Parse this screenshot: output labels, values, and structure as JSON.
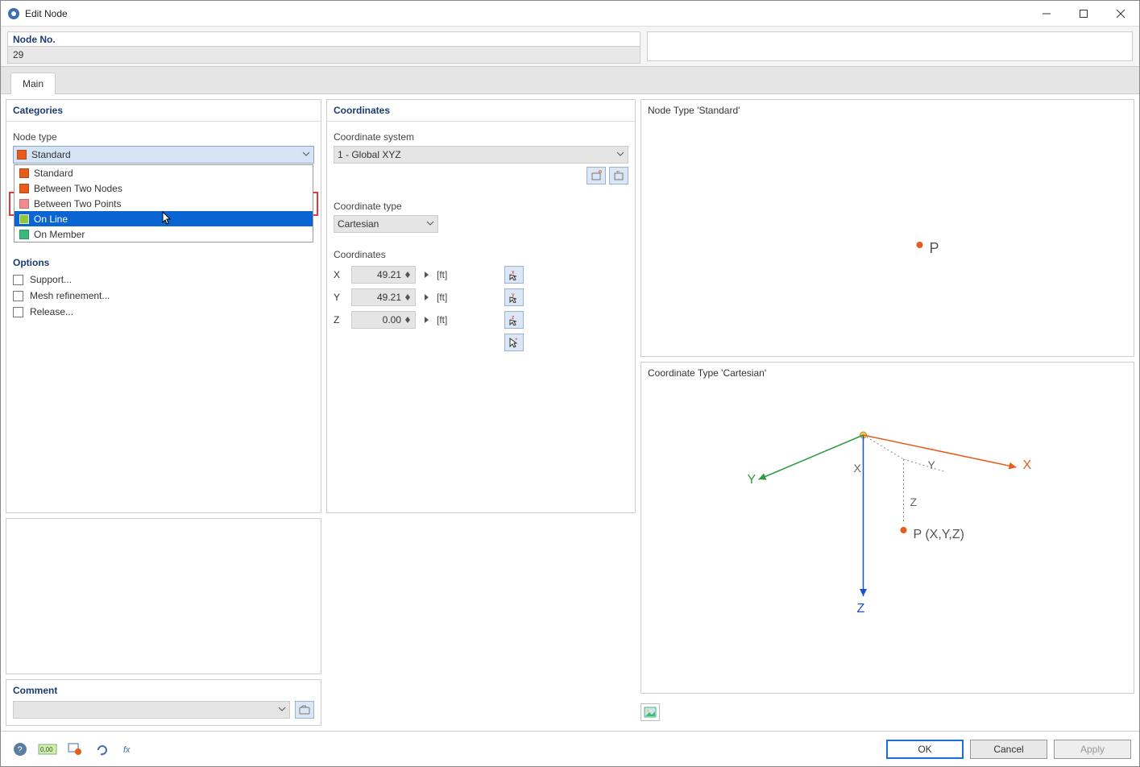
{
  "window": {
    "title": "Edit Node"
  },
  "nodeNo": {
    "label": "Node No.",
    "value": "29"
  },
  "tabs": {
    "main": "Main"
  },
  "categories": {
    "header": "Categories",
    "nodeTypeLabel": "Node type",
    "selected": "Standard",
    "items": [
      {
        "label": "Standard",
        "color": "#e65c1a"
      },
      {
        "label": "Between Two Nodes",
        "color": "#e65c1a"
      },
      {
        "label": "Between Two Points",
        "color": "#f08c8c"
      },
      {
        "label": "On Line",
        "color": "#8dc63f"
      },
      {
        "label": "On Member",
        "color": "#3cb878"
      }
    ],
    "optionsHeader": "Options",
    "checks": {
      "support": "Support...",
      "mesh": "Mesh refinement...",
      "release": "Release..."
    }
  },
  "coordinates": {
    "header": "Coordinates",
    "systemLabel": "Coordinate system",
    "system": "1 - Global XYZ",
    "typeLabel": "Coordinate type",
    "type": "Cartesian",
    "valuesLabel": "Coordinates",
    "rows": [
      {
        "axis": "X",
        "value": "49.21",
        "unit": "[ft]"
      },
      {
        "axis": "Y",
        "value": "49.21",
        "unit": "[ft]"
      },
      {
        "axis": "Z",
        "value": "0.00",
        "unit": "[ft]"
      }
    ]
  },
  "preview": {
    "standardLabel": "Node Type 'Standard'",
    "cartesianLabel": "Coordinate Type 'Cartesian'",
    "pointLabel": "P",
    "pointLabel2": "P (X,Y,Z)",
    "axes": {
      "x": "X",
      "y": "Y",
      "z": "Z"
    }
  },
  "comment": {
    "header": "Comment"
  },
  "buttons": {
    "ok": "OK",
    "cancel": "Cancel",
    "apply": "Apply"
  },
  "colors": {
    "standard": "#e65c1a",
    "online": "#8dc63f",
    "xaxis": "#e65c1a",
    "yaxis": "#2e9b3f",
    "zaxis": "#1a4fd6"
  }
}
